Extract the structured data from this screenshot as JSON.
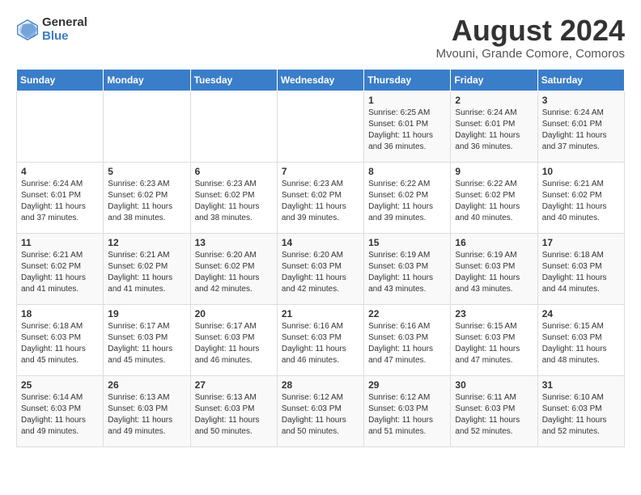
{
  "logo": {
    "general": "General",
    "blue": "Blue"
  },
  "title": {
    "month_year": "August 2024",
    "location": "Mvouni, Grande Comore, Comoros"
  },
  "headers": [
    "Sunday",
    "Monday",
    "Tuesday",
    "Wednesday",
    "Thursday",
    "Friday",
    "Saturday"
  ],
  "weeks": [
    [
      {
        "day": "",
        "info": ""
      },
      {
        "day": "",
        "info": ""
      },
      {
        "day": "",
        "info": ""
      },
      {
        "day": "",
        "info": ""
      },
      {
        "day": "1",
        "sunrise": "Sunrise: 6:25 AM",
        "sunset": "Sunset: 6:01 PM",
        "daylight": "Daylight: 11 hours and 36 minutes."
      },
      {
        "day": "2",
        "sunrise": "Sunrise: 6:24 AM",
        "sunset": "Sunset: 6:01 PM",
        "daylight": "Daylight: 11 hours and 36 minutes."
      },
      {
        "day": "3",
        "sunrise": "Sunrise: 6:24 AM",
        "sunset": "Sunset: 6:01 PM",
        "daylight": "Daylight: 11 hours and 37 minutes."
      }
    ],
    [
      {
        "day": "4",
        "sunrise": "Sunrise: 6:24 AM",
        "sunset": "Sunset: 6:01 PM",
        "daylight": "Daylight: 11 hours and 37 minutes."
      },
      {
        "day": "5",
        "sunrise": "Sunrise: 6:23 AM",
        "sunset": "Sunset: 6:02 PM",
        "daylight": "Daylight: 11 hours and 38 minutes."
      },
      {
        "day": "6",
        "sunrise": "Sunrise: 6:23 AM",
        "sunset": "Sunset: 6:02 PM",
        "daylight": "Daylight: 11 hours and 38 minutes."
      },
      {
        "day": "7",
        "sunrise": "Sunrise: 6:23 AM",
        "sunset": "Sunset: 6:02 PM",
        "daylight": "Daylight: 11 hours and 39 minutes."
      },
      {
        "day": "8",
        "sunrise": "Sunrise: 6:22 AM",
        "sunset": "Sunset: 6:02 PM",
        "daylight": "Daylight: 11 hours and 39 minutes."
      },
      {
        "day": "9",
        "sunrise": "Sunrise: 6:22 AM",
        "sunset": "Sunset: 6:02 PM",
        "daylight": "Daylight: 11 hours and 40 minutes."
      },
      {
        "day": "10",
        "sunrise": "Sunrise: 6:21 AM",
        "sunset": "Sunset: 6:02 PM",
        "daylight": "Daylight: 11 hours and 40 minutes."
      }
    ],
    [
      {
        "day": "11",
        "sunrise": "Sunrise: 6:21 AM",
        "sunset": "Sunset: 6:02 PM",
        "daylight": "Daylight: 11 hours and 41 minutes."
      },
      {
        "day": "12",
        "sunrise": "Sunrise: 6:21 AM",
        "sunset": "Sunset: 6:02 PM",
        "daylight": "Daylight: 11 hours and 41 minutes."
      },
      {
        "day": "13",
        "sunrise": "Sunrise: 6:20 AM",
        "sunset": "Sunset: 6:02 PM",
        "daylight": "Daylight: 11 hours and 42 minutes."
      },
      {
        "day": "14",
        "sunrise": "Sunrise: 6:20 AM",
        "sunset": "Sunset: 6:03 PM",
        "daylight": "Daylight: 11 hours and 42 minutes."
      },
      {
        "day": "15",
        "sunrise": "Sunrise: 6:19 AM",
        "sunset": "Sunset: 6:03 PM",
        "daylight": "Daylight: 11 hours and 43 minutes."
      },
      {
        "day": "16",
        "sunrise": "Sunrise: 6:19 AM",
        "sunset": "Sunset: 6:03 PM",
        "daylight": "Daylight: 11 hours and 43 minutes."
      },
      {
        "day": "17",
        "sunrise": "Sunrise: 6:18 AM",
        "sunset": "Sunset: 6:03 PM",
        "daylight": "Daylight: 11 hours and 44 minutes."
      }
    ],
    [
      {
        "day": "18",
        "sunrise": "Sunrise: 6:18 AM",
        "sunset": "Sunset: 6:03 PM",
        "daylight": "Daylight: 11 hours and 45 minutes."
      },
      {
        "day": "19",
        "sunrise": "Sunrise: 6:17 AM",
        "sunset": "Sunset: 6:03 PM",
        "daylight": "Daylight: 11 hours and 45 minutes."
      },
      {
        "day": "20",
        "sunrise": "Sunrise: 6:17 AM",
        "sunset": "Sunset: 6:03 PM",
        "daylight": "Daylight: 11 hours and 46 minutes."
      },
      {
        "day": "21",
        "sunrise": "Sunrise: 6:16 AM",
        "sunset": "Sunset: 6:03 PM",
        "daylight": "Daylight: 11 hours and 46 minutes."
      },
      {
        "day": "22",
        "sunrise": "Sunrise: 6:16 AM",
        "sunset": "Sunset: 6:03 PM",
        "daylight": "Daylight: 11 hours and 47 minutes."
      },
      {
        "day": "23",
        "sunrise": "Sunrise: 6:15 AM",
        "sunset": "Sunset: 6:03 PM",
        "daylight": "Daylight: 11 hours and 47 minutes."
      },
      {
        "day": "24",
        "sunrise": "Sunrise: 6:15 AM",
        "sunset": "Sunset: 6:03 PM",
        "daylight": "Daylight: 11 hours and 48 minutes."
      }
    ],
    [
      {
        "day": "25",
        "sunrise": "Sunrise: 6:14 AM",
        "sunset": "Sunset: 6:03 PM",
        "daylight": "Daylight: 11 hours and 49 minutes."
      },
      {
        "day": "26",
        "sunrise": "Sunrise: 6:13 AM",
        "sunset": "Sunset: 6:03 PM",
        "daylight": "Daylight: 11 hours and 49 minutes."
      },
      {
        "day": "27",
        "sunrise": "Sunrise: 6:13 AM",
        "sunset": "Sunset: 6:03 PM",
        "daylight": "Daylight: 11 hours and 50 minutes."
      },
      {
        "day": "28",
        "sunrise": "Sunrise: 6:12 AM",
        "sunset": "Sunset: 6:03 PM",
        "daylight": "Daylight: 11 hours and 50 minutes."
      },
      {
        "day": "29",
        "sunrise": "Sunrise: 6:12 AM",
        "sunset": "Sunset: 6:03 PM",
        "daylight": "Daylight: 11 hours and 51 minutes."
      },
      {
        "day": "30",
        "sunrise": "Sunrise: 6:11 AM",
        "sunset": "Sunset: 6:03 PM",
        "daylight": "Daylight: 11 hours and 52 minutes."
      },
      {
        "day": "31",
        "sunrise": "Sunrise: 6:10 AM",
        "sunset": "Sunset: 6:03 PM",
        "daylight": "Daylight: 11 hours and 52 minutes."
      }
    ]
  ]
}
